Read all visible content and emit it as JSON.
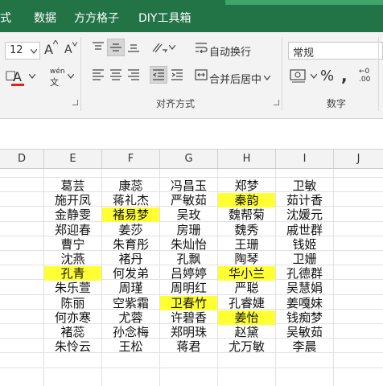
{
  "menu": {
    "tabs": [
      "式",
      "数据",
      "方方格子",
      "DIY工具箱"
    ]
  },
  "ribbon": {
    "font_size": "12",
    "font_grow_label": "A",
    "font_shrink_label": "A",
    "wen_label": "wén",
    "font_color_label": "A",
    "wrap_text_label": "自动换行",
    "merge_center_label": "合并后居中",
    "number_format_value": "常规",
    "percent_label": "%",
    "alignment_group_label": "对齐方式",
    "number_group_label": "数字",
    "colors": {
      "accent": "#227447",
      "font_color": "#e02020",
      "highlight": "#ffff33"
    }
  },
  "columns": [
    "D",
    "E",
    "F",
    "G",
    "H",
    "I",
    "J"
  ],
  "grid": {
    "rows": [
      [
        "",
        "葛芸",
        "康蕊",
        "冯昌玉",
        "郑梦",
        "卫敏",
        ""
      ],
      [
        "",
        "施开凤",
        "蒋礼杰",
        "严敏茹",
        "秦韵",
        "茹计香",
        ""
      ],
      [
        "",
        "金静雯",
        "褚易梦",
        "吴玫",
        "魏帮菊",
        "沈媛元",
        ""
      ],
      [
        "",
        "郑迎春",
        "姜莎",
        "房珊",
        "魏秀",
        "戚世群",
        ""
      ],
      [
        "",
        "曹宁",
        "朱育彤",
        "朱灿怡",
        "王珊",
        "钱姬",
        ""
      ],
      [
        "",
        "沈燕",
        "褚丹",
        "孔飘",
        "陶琴",
        "卫姗",
        ""
      ],
      [
        "",
        "孔青",
        "何发弟",
        "吕婷婷",
        "华小兰",
        "孔德群",
        ""
      ],
      [
        "",
        "朱乐萱",
        "周瑾",
        "周明红",
        "严聪",
        "吴慧娟",
        ""
      ],
      [
        "",
        "陈丽",
        "空紫霜",
        "卫春竹",
        "孔睿婕",
        "姜嘎妹",
        ""
      ],
      [
        "",
        "何亦寒",
        "尤蓉",
        "许碧香",
        "姜怡",
        "钱痴梦",
        ""
      ],
      [
        "",
        "褚蕊",
        "孙念梅",
        "郑明珠",
        "赵黛",
        "吴敏茹",
        ""
      ],
      [
        "",
        "朱怜云",
        "王松",
        "蒋君",
        "尤万敏",
        "李晨",
        ""
      ]
    ],
    "highlighted": [
      [
        1,
        4
      ],
      [
        2,
        2
      ],
      [
        6,
        1
      ],
      [
        6,
        4
      ],
      [
        8,
        3
      ],
      [
        9,
        4
      ]
    ]
  }
}
